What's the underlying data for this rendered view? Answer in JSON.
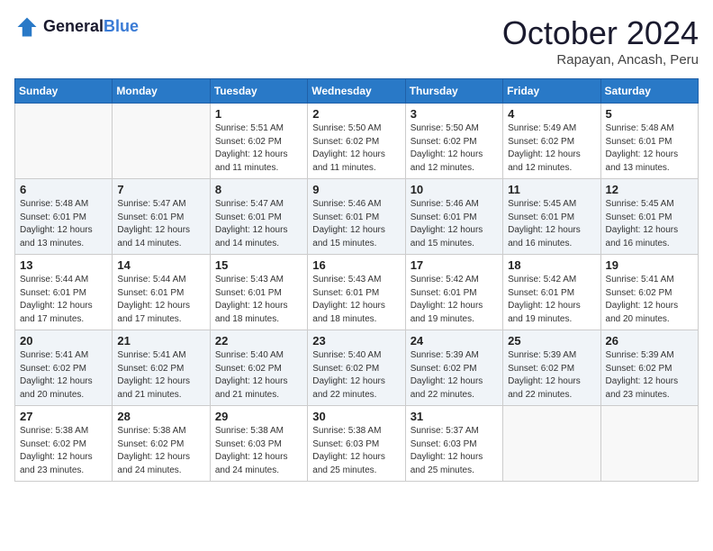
{
  "header": {
    "logo_line1": "General",
    "logo_line2": "Blue",
    "month": "October 2024",
    "location": "Rapayan, Ancash, Peru"
  },
  "weekdays": [
    "Sunday",
    "Monday",
    "Tuesday",
    "Wednesday",
    "Thursday",
    "Friday",
    "Saturday"
  ],
  "weeks": [
    [
      {
        "day": "",
        "info": ""
      },
      {
        "day": "",
        "info": ""
      },
      {
        "day": "1",
        "info": "Sunrise: 5:51 AM\nSunset: 6:02 PM\nDaylight: 12 hours\nand 11 minutes."
      },
      {
        "day": "2",
        "info": "Sunrise: 5:50 AM\nSunset: 6:02 PM\nDaylight: 12 hours\nand 11 minutes."
      },
      {
        "day": "3",
        "info": "Sunrise: 5:50 AM\nSunset: 6:02 PM\nDaylight: 12 hours\nand 12 minutes."
      },
      {
        "day": "4",
        "info": "Sunrise: 5:49 AM\nSunset: 6:02 PM\nDaylight: 12 hours\nand 12 minutes."
      },
      {
        "day": "5",
        "info": "Sunrise: 5:48 AM\nSunset: 6:01 PM\nDaylight: 12 hours\nand 13 minutes."
      }
    ],
    [
      {
        "day": "6",
        "info": "Sunrise: 5:48 AM\nSunset: 6:01 PM\nDaylight: 12 hours\nand 13 minutes."
      },
      {
        "day": "7",
        "info": "Sunrise: 5:47 AM\nSunset: 6:01 PM\nDaylight: 12 hours\nand 14 minutes."
      },
      {
        "day": "8",
        "info": "Sunrise: 5:47 AM\nSunset: 6:01 PM\nDaylight: 12 hours\nand 14 minutes."
      },
      {
        "day": "9",
        "info": "Sunrise: 5:46 AM\nSunset: 6:01 PM\nDaylight: 12 hours\nand 15 minutes."
      },
      {
        "day": "10",
        "info": "Sunrise: 5:46 AM\nSunset: 6:01 PM\nDaylight: 12 hours\nand 15 minutes."
      },
      {
        "day": "11",
        "info": "Sunrise: 5:45 AM\nSunset: 6:01 PM\nDaylight: 12 hours\nand 16 minutes."
      },
      {
        "day": "12",
        "info": "Sunrise: 5:45 AM\nSunset: 6:01 PM\nDaylight: 12 hours\nand 16 minutes."
      }
    ],
    [
      {
        "day": "13",
        "info": "Sunrise: 5:44 AM\nSunset: 6:01 PM\nDaylight: 12 hours\nand 17 minutes."
      },
      {
        "day": "14",
        "info": "Sunrise: 5:44 AM\nSunset: 6:01 PM\nDaylight: 12 hours\nand 17 minutes."
      },
      {
        "day": "15",
        "info": "Sunrise: 5:43 AM\nSunset: 6:01 PM\nDaylight: 12 hours\nand 18 minutes."
      },
      {
        "day": "16",
        "info": "Sunrise: 5:43 AM\nSunset: 6:01 PM\nDaylight: 12 hours\nand 18 minutes."
      },
      {
        "day": "17",
        "info": "Sunrise: 5:42 AM\nSunset: 6:01 PM\nDaylight: 12 hours\nand 19 minutes."
      },
      {
        "day": "18",
        "info": "Sunrise: 5:42 AM\nSunset: 6:01 PM\nDaylight: 12 hours\nand 19 minutes."
      },
      {
        "day": "19",
        "info": "Sunrise: 5:41 AM\nSunset: 6:02 PM\nDaylight: 12 hours\nand 20 minutes."
      }
    ],
    [
      {
        "day": "20",
        "info": "Sunrise: 5:41 AM\nSunset: 6:02 PM\nDaylight: 12 hours\nand 20 minutes."
      },
      {
        "day": "21",
        "info": "Sunrise: 5:41 AM\nSunset: 6:02 PM\nDaylight: 12 hours\nand 21 minutes."
      },
      {
        "day": "22",
        "info": "Sunrise: 5:40 AM\nSunset: 6:02 PM\nDaylight: 12 hours\nand 21 minutes."
      },
      {
        "day": "23",
        "info": "Sunrise: 5:40 AM\nSunset: 6:02 PM\nDaylight: 12 hours\nand 22 minutes."
      },
      {
        "day": "24",
        "info": "Sunrise: 5:39 AM\nSunset: 6:02 PM\nDaylight: 12 hours\nand 22 minutes."
      },
      {
        "day": "25",
        "info": "Sunrise: 5:39 AM\nSunset: 6:02 PM\nDaylight: 12 hours\nand 22 minutes."
      },
      {
        "day": "26",
        "info": "Sunrise: 5:39 AM\nSunset: 6:02 PM\nDaylight: 12 hours\nand 23 minutes."
      }
    ],
    [
      {
        "day": "27",
        "info": "Sunrise: 5:38 AM\nSunset: 6:02 PM\nDaylight: 12 hours\nand 23 minutes."
      },
      {
        "day": "28",
        "info": "Sunrise: 5:38 AM\nSunset: 6:02 PM\nDaylight: 12 hours\nand 24 minutes."
      },
      {
        "day": "29",
        "info": "Sunrise: 5:38 AM\nSunset: 6:03 PM\nDaylight: 12 hours\nand 24 minutes."
      },
      {
        "day": "30",
        "info": "Sunrise: 5:38 AM\nSunset: 6:03 PM\nDaylight: 12 hours\nand 25 minutes."
      },
      {
        "day": "31",
        "info": "Sunrise: 5:37 AM\nSunset: 6:03 PM\nDaylight: 12 hours\nand 25 minutes."
      },
      {
        "day": "",
        "info": ""
      },
      {
        "day": "",
        "info": ""
      }
    ]
  ]
}
